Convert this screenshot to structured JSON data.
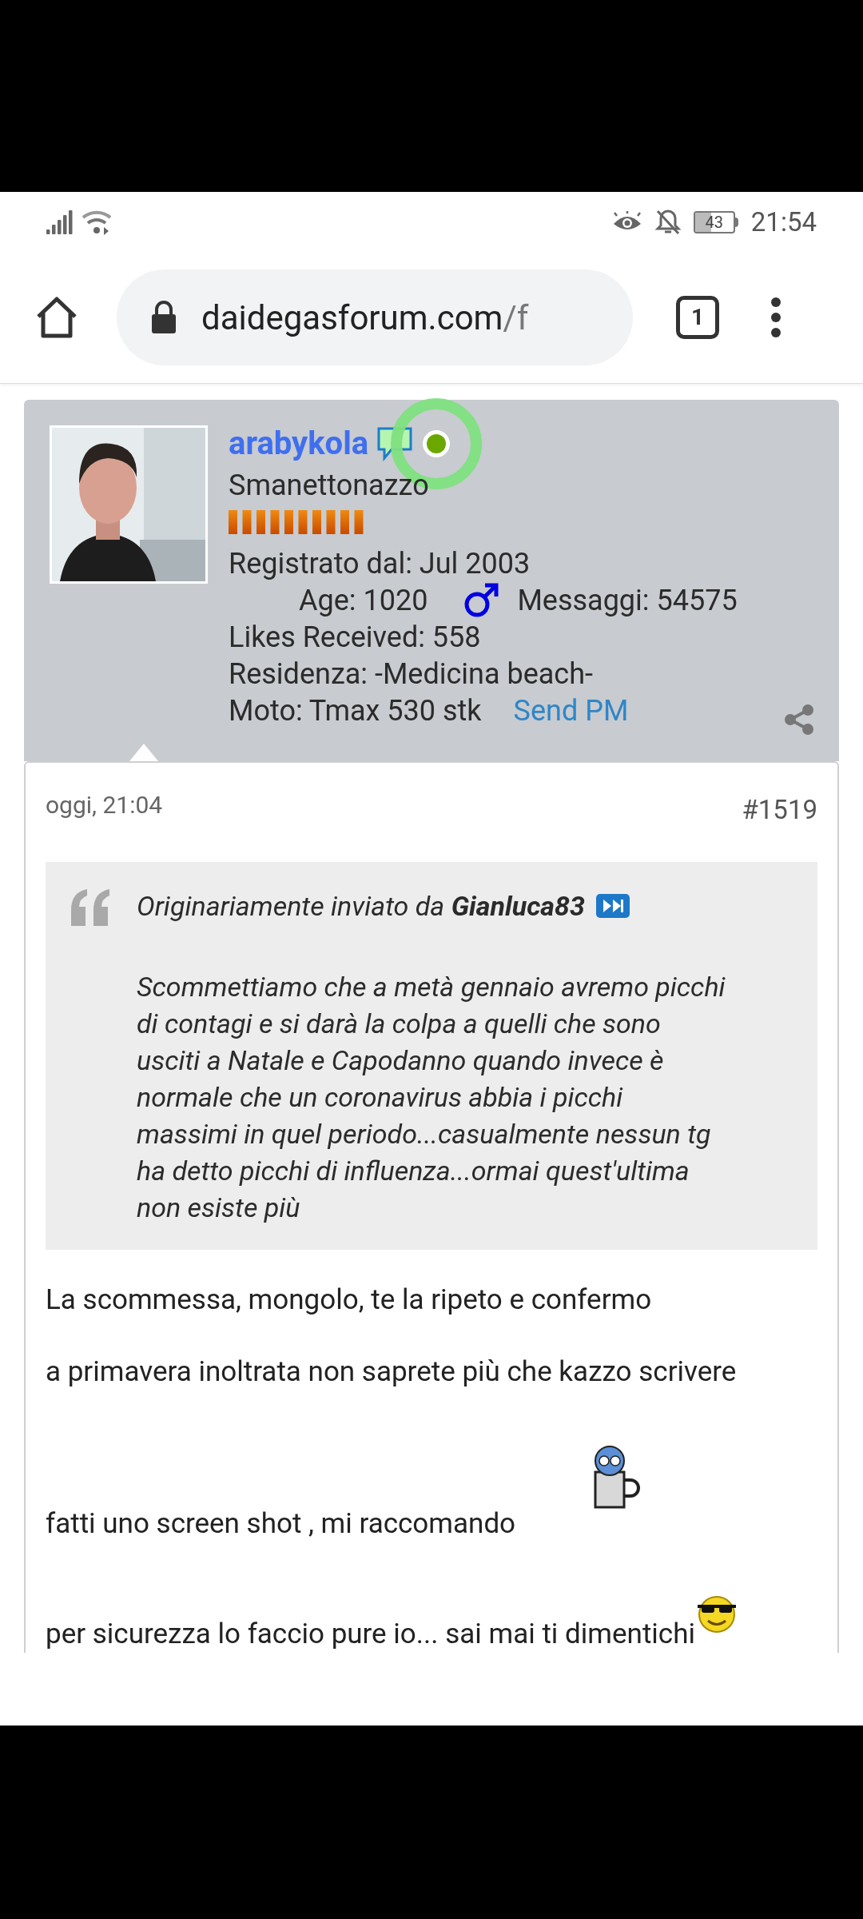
{
  "status_bar": {
    "battery": "43",
    "time": "21:54"
  },
  "browser": {
    "url_host": "daidegasforum.com",
    "url_path": "/f",
    "tab_count": "1"
  },
  "profile": {
    "username": "arabykola",
    "online": true,
    "title": "Smanettonazzo",
    "registered": "Registrato dal: Jul 2003",
    "age": "Age: 1020",
    "messages": "Messaggi: 54575",
    "likes": "Likes Received: 558",
    "residence": "Residenza: -Medicina beach-",
    "moto": "Moto: Tmax 530 stk",
    "send_pm": "Send PM"
  },
  "post": {
    "date": "oggi, 21:04",
    "number": "#1519",
    "quote": {
      "attribution": "Originariamente inviato da **Gianluca83**",
      "text": "Scommettiamo che a metà gennaio avremo picchi di contagi e si darà la colpa a quelli che sono usciti a Natale e Capodanno quando invece è normale che un coronavirus abbia i picchi massimi in quel periodo...casualmente nessun tg ha detto picchi di influenza...ormai quest'ultima non esiste più"
    },
    "body": [
      {
        "kind": "text",
        "text": "La scommessa, mongolo, te la ripeto e confermo"
      },
      {
        "kind": "text",
        "text": "a primavera inoltrata non saprete più che kazzo scrivere"
      },
      {
        "kind": "beer"
      },
      {
        "kind": "text",
        "text": "fatti uno screen shot , mi raccomando"
      },
      {
        "kind": "text_cool",
        "text": "per sicurezza lo faccio pure io... sai mai ti dimentichi"
      }
    ]
  }
}
